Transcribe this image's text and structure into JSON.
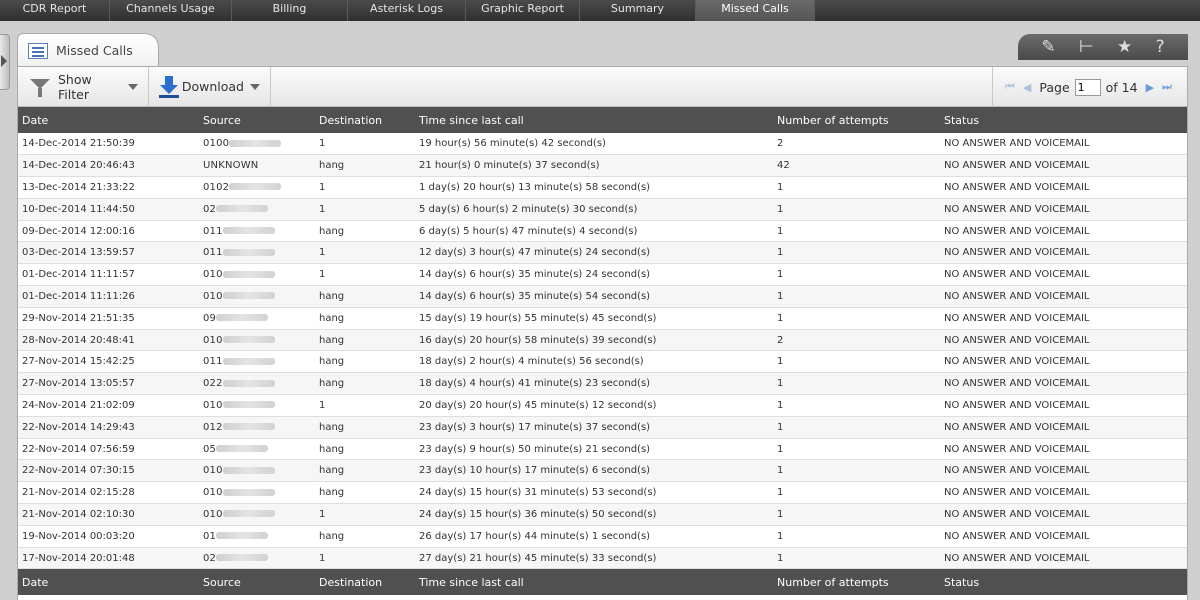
{
  "nav": [
    {
      "label": "CDR Report",
      "w": 110
    },
    {
      "label": "Channels Usage",
      "w": 122
    },
    {
      "label": "Billing",
      "w": 116
    },
    {
      "label": "Asterisk Logs",
      "w": 118
    },
    {
      "label": "Graphic Report",
      "w": 114
    },
    {
      "label": "Summary",
      "w": 116
    },
    {
      "label": "Missed Calls",
      "w": 119,
      "active": true
    }
  ],
  "tab": {
    "title": "Missed Calls"
  },
  "tools": [
    "edit-icon",
    "detach-icon",
    "star-icon",
    "help-icon"
  ],
  "toolbar": {
    "filter_label": "Show Filter",
    "download_label": "Download"
  },
  "pager": {
    "page_label": "Page",
    "page_value": "1",
    "of_label": "of 14"
  },
  "columns": [
    "Date",
    "Source",
    "Destination",
    "Time since last call",
    "Number of attempts",
    "Status"
  ],
  "rows": [
    {
      "date": "14-Dec-2014 21:50:39",
      "source": "0100",
      "dest": "1",
      "since": "19 hour(s) 56 minute(s) 42 second(s)",
      "attempts": "2",
      "status": "NO ANSWER AND VOICEMAIL"
    },
    {
      "date": "14-Dec-2014 20:46:43",
      "source": "UNKNOWN",
      "dest": "hang",
      "since": "21 hour(s) 0 minute(s) 37 second(s)",
      "attempts": "42",
      "status": "NO ANSWER AND VOICEMAIL"
    },
    {
      "date": "13-Dec-2014 21:33:22",
      "source": "0102",
      "dest": "1",
      "since": "1 day(s) 20 hour(s) 13 minute(s) 58 second(s)",
      "attempts": "1",
      "status": "NO ANSWER AND VOICEMAIL"
    },
    {
      "date": "10-Dec-2014 11:44:50",
      "source": "02",
      "dest": "1",
      "since": "5 day(s) 6 hour(s) 2 minute(s) 30 second(s)",
      "attempts": "1",
      "status": "NO ANSWER AND VOICEMAIL"
    },
    {
      "date": "09-Dec-2014 12:00:16",
      "source": "011",
      "dest": "hang",
      "since": "6 day(s) 5 hour(s) 47 minute(s) 4 second(s)",
      "attempts": "1",
      "status": "NO ANSWER AND VOICEMAIL"
    },
    {
      "date": "03-Dec-2014 13:59:57",
      "source": "011",
      "dest": "1",
      "since": "12 day(s) 3 hour(s) 47 minute(s) 24 second(s)",
      "attempts": "1",
      "status": "NO ANSWER AND VOICEMAIL"
    },
    {
      "date": "01-Dec-2014 11:11:57",
      "source": "010",
      "dest": "1",
      "since": "14 day(s) 6 hour(s) 35 minute(s) 24 second(s)",
      "attempts": "1",
      "status": "NO ANSWER AND VOICEMAIL"
    },
    {
      "date": "01-Dec-2014 11:11:26",
      "source": "010",
      "dest": "hang",
      "since": "14 day(s) 6 hour(s) 35 minute(s) 54 second(s)",
      "attempts": "1",
      "status": "NO ANSWER AND VOICEMAIL"
    },
    {
      "date": "29-Nov-2014 21:51:35",
      "source": "09",
      "dest": "hang",
      "since": "15 day(s) 19 hour(s) 55 minute(s) 45 second(s)",
      "attempts": "1",
      "status": "NO ANSWER AND VOICEMAIL"
    },
    {
      "date": "28-Nov-2014 20:48:41",
      "source": "010",
      "dest": "hang",
      "since": "16 day(s) 20 hour(s) 58 minute(s) 39 second(s)",
      "attempts": "2",
      "status": "NO ANSWER AND VOICEMAIL"
    },
    {
      "date": "27-Nov-2014 15:42:25",
      "source": "011",
      "dest": "hang",
      "since": "18 day(s) 2 hour(s) 4 minute(s) 56 second(s)",
      "attempts": "1",
      "status": "NO ANSWER AND VOICEMAIL"
    },
    {
      "date": "27-Nov-2014 13:05:57",
      "source": "022",
      "dest": "hang",
      "since": "18 day(s) 4 hour(s) 41 minute(s) 23 second(s)",
      "attempts": "1",
      "status": "NO ANSWER AND VOICEMAIL"
    },
    {
      "date": "24-Nov-2014 21:02:09",
      "source": "010",
      "dest": "1",
      "since": "20 day(s) 20 hour(s) 45 minute(s) 12 second(s)",
      "attempts": "1",
      "status": "NO ANSWER AND VOICEMAIL"
    },
    {
      "date": "22-Nov-2014 14:29:43",
      "source": "012",
      "dest": "hang",
      "since": "23 day(s) 3 hour(s) 17 minute(s) 37 second(s)",
      "attempts": "1",
      "status": "NO ANSWER AND VOICEMAIL"
    },
    {
      "date": "22-Nov-2014 07:56:59",
      "source": "05",
      "dest": "hang",
      "since": "23 day(s) 9 hour(s) 50 minute(s) 21 second(s)",
      "attempts": "1",
      "status": "NO ANSWER AND VOICEMAIL"
    },
    {
      "date": "22-Nov-2014 07:30:15",
      "source": "010",
      "dest": "hang",
      "since": "23 day(s) 10 hour(s) 17 minute(s) 6 second(s)",
      "attempts": "1",
      "status": "NO ANSWER AND VOICEMAIL"
    },
    {
      "date": "21-Nov-2014 02:15:28",
      "source": "010",
      "dest": "hang",
      "since": "24 day(s) 15 hour(s) 31 minute(s) 53 second(s)",
      "attempts": "1",
      "status": "NO ANSWER AND VOICEMAIL"
    },
    {
      "date": "21-Nov-2014 02:10:30",
      "source": "010",
      "dest": "1",
      "since": "24 day(s) 15 hour(s) 36 minute(s) 50 second(s)",
      "attempts": "1",
      "status": "NO ANSWER AND VOICEMAIL"
    },
    {
      "date": "19-Nov-2014 00:03:20",
      "source": "01",
      "dest": "hang",
      "since": "26 day(s) 17 hour(s) 44 minute(s) 1 second(s)",
      "attempts": "1",
      "status": "NO ANSWER AND VOICEMAIL"
    },
    {
      "date": "17-Nov-2014 20:01:48",
      "source": "02",
      "dest": "1",
      "since": "27 day(s) 21 hour(s) 45 minute(s) 33 second(s)",
      "attempts": "1",
      "status": "NO ANSWER AND VOICEMAIL"
    }
  ]
}
